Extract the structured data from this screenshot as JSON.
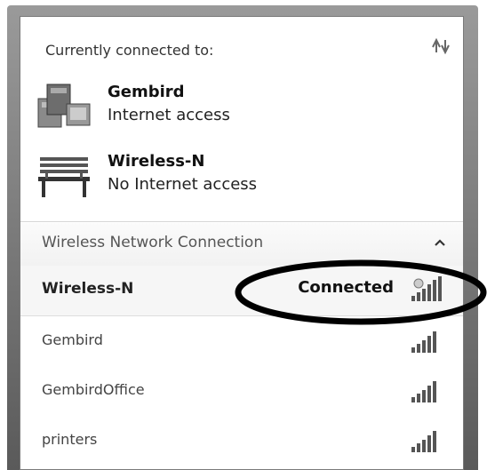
{
  "panel": {
    "header": "Currently connected to:",
    "connections": [
      {
        "name": "Gembird",
        "status": "Internet access",
        "icon": "computer-network-icon"
      },
      {
        "name": "Wireless-N",
        "status": "No Internet access",
        "icon": "park-bench-icon"
      }
    ],
    "section_title": "Wireless Network Connection",
    "networks": [
      {
        "label": "Wireless-N",
        "status": "Connected",
        "active": true
      },
      {
        "label": "Gembird",
        "status": ""
      },
      {
        "label": "GembirdOffice",
        "status": ""
      },
      {
        "label": "printers",
        "status": ""
      }
    ]
  },
  "colors": {
    "panel_bg": "#ffffff",
    "frame": "#7a7a7a",
    "annotation": "#000000"
  }
}
